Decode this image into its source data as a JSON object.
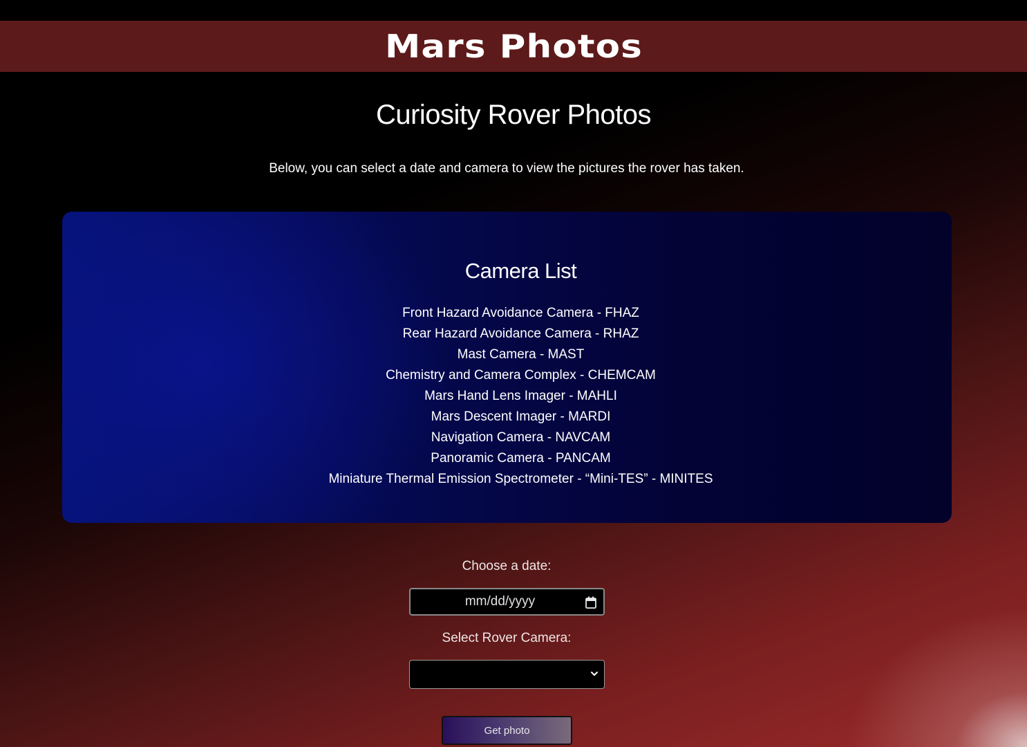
{
  "header": {
    "title": "Mars Photos"
  },
  "main": {
    "title": "Curiosity Rover Photos",
    "intro": "Below, you can select a date and camera to view the pictures the rover has taken."
  },
  "camera_panel": {
    "title": "Camera List",
    "cameras": [
      "Front Hazard Avoidance Camera - FHAZ",
      "Rear Hazard Avoidance Camera - RHAZ",
      "Mast Camera - MAST",
      "Chemistry and Camera Complex - CHEMCAM",
      "Mars Hand Lens Imager - MAHLI",
      "Mars Descent Imager - MARDI",
      "Navigation Camera - NAVCAM",
      "Panoramic Camera - PANCAM",
      "Miniature Thermal Emission Spectrometer - “Mini-TES” - MINITES"
    ]
  },
  "form": {
    "date_label": "Choose a date:",
    "date_placeholder": "mm/dd/yyyy",
    "camera_label": "Select Rover Camera:",
    "camera_value": "",
    "submit_label": "Get photo"
  },
  "colors": {
    "header_bg": "#5d1a1a",
    "panel_bg": "#050a55",
    "page_bg": "#000000"
  }
}
